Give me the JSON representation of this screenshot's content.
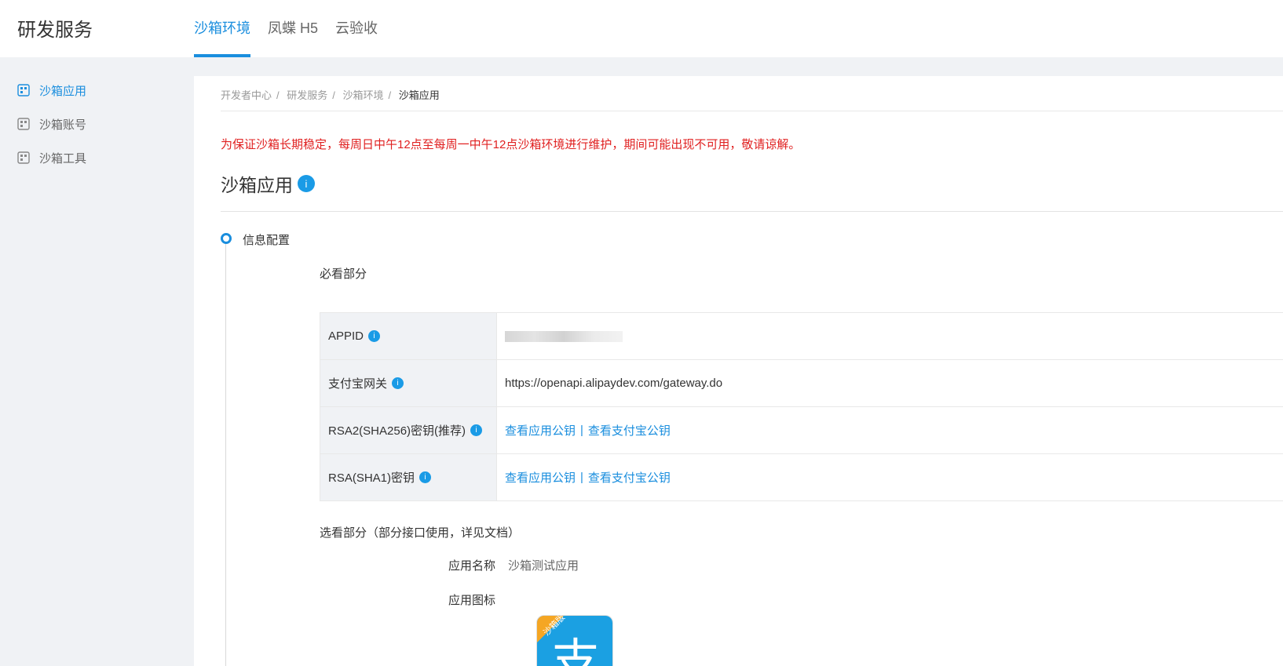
{
  "header": {
    "brand": "研发服务",
    "tabs": [
      {
        "label": "沙箱环境",
        "active": true
      },
      {
        "label": "凤蝶 H5",
        "active": false
      },
      {
        "label": "云验收",
        "active": false
      }
    ]
  },
  "sidebar": {
    "items": [
      {
        "label": "沙箱应用",
        "icon": "app-grid-icon",
        "active": true
      },
      {
        "label": "沙箱账号",
        "icon": "app-grid-icon",
        "active": false
      },
      {
        "label": "沙箱工具",
        "icon": "app-grid-icon",
        "active": false
      }
    ]
  },
  "breadcrumb": {
    "items": [
      "开发者中心",
      "研发服务",
      "沙箱环境"
    ],
    "separator": "/",
    "current": "沙箱应用"
  },
  "notice": "为保证沙箱长期稳定，每周日中午12点至每周一中午12点沙箱环境进行维护，期间可能出现不可用，敬请谅解。",
  "page": {
    "title": "沙箱应用",
    "info_mark": "i"
  },
  "step": {
    "label": "信息配置"
  },
  "must_section": {
    "title": "必看部分",
    "rows": [
      {
        "key": "APPID",
        "info": "i",
        "value_hidden": true
      },
      {
        "key": "支付宝网关",
        "info": "i",
        "value": "https://openapi.alipaydev.com/gateway.do"
      },
      {
        "key": "RSA2(SHA256)密钥(推荐)",
        "info": "i",
        "link1": "查看应用公钥",
        "sep": "|",
        "link2": "查看支付宝公钥"
      },
      {
        "key": "RSA(SHA1)密钥",
        "info": "i",
        "link1": "查看应用公钥",
        "sep": "|",
        "link2": "查看支付宝公钥"
      }
    ]
  },
  "optional_section": {
    "title": "选看部分（部分接口使用，详见文档）",
    "app_name_label": "应用名称",
    "app_name_value": "沙箱测试应用",
    "app_icon_label": "应用图标",
    "app_icon_ribbon": "沙箱版",
    "app_icon_glyph": "支"
  },
  "colors": {
    "accent": "#1a8ede",
    "notice": "#e02020",
    "badge": "#1a9be6",
    "alipay_blue": "#1ba0e2",
    "ribbon_orange": "#f5a623"
  }
}
